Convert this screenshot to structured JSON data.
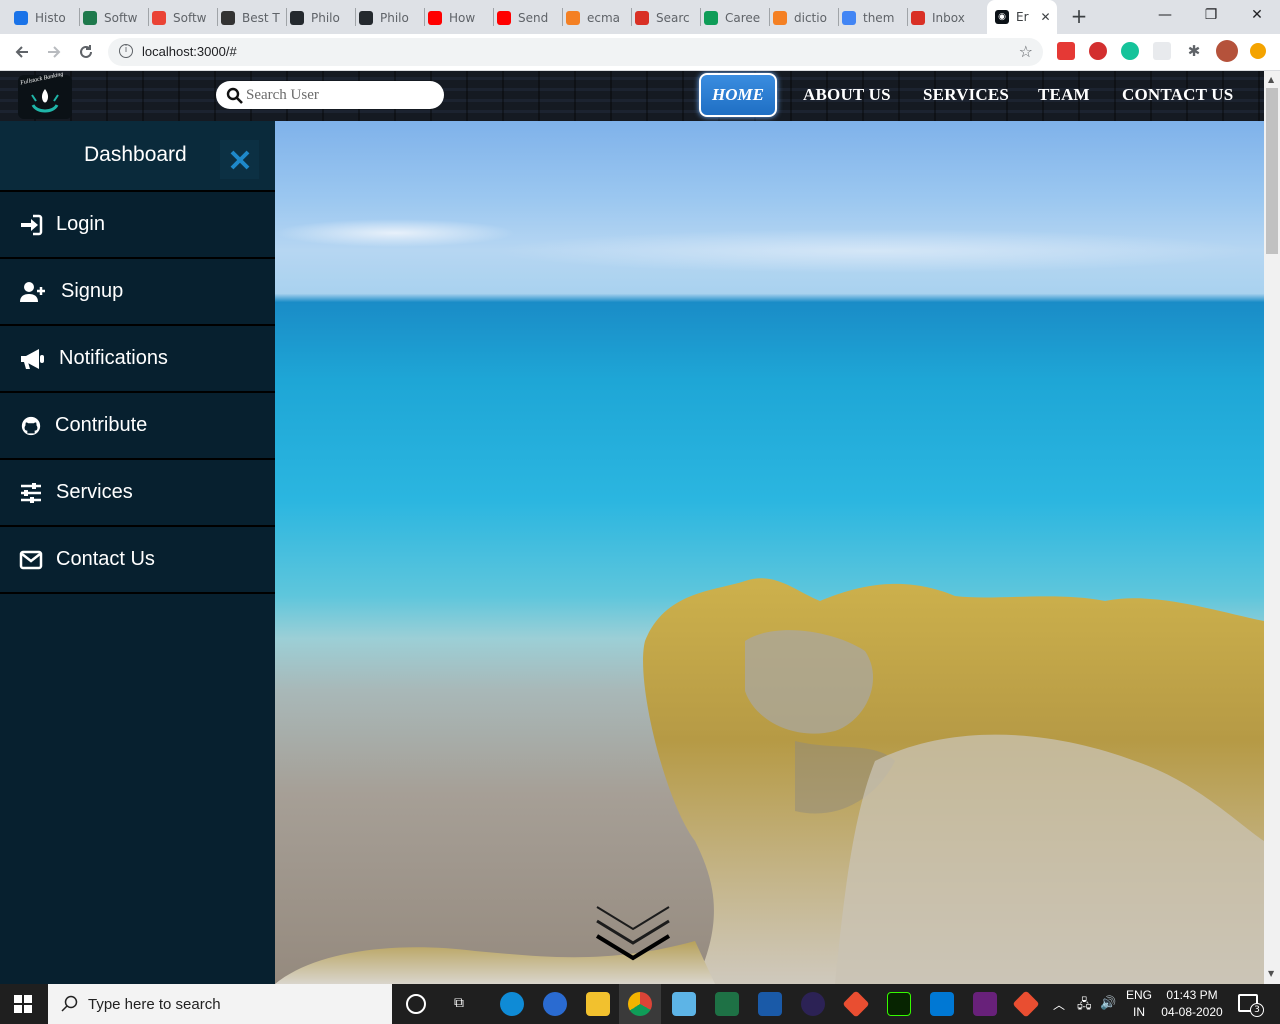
{
  "browser": {
    "tabs": [
      {
        "label": "Histo",
        "color": "#1a73e8"
      },
      {
        "label": "Softw",
        "color": "#1f7a4d"
      },
      {
        "label": "Softw",
        "color": "#ea4335"
      },
      {
        "label": "Best T",
        "color": "#333333"
      },
      {
        "label": "Philo",
        "color": "#24292e"
      },
      {
        "label": "Philo",
        "color": "#24292e"
      },
      {
        "label": "How",
        "color": "#ff0000"
      },
      {
        "label": "Send",
        "color": "#ff0000"
      },
      {
        "label": "ecma",
        "color": "#f48024"
      },
      {
        "label": "Searc",
        "color": "#d93025"
      },
      {
        "label": "Caree",
        "color": "#0f9d58"
      },
      {
        "label": "dictio",
        "color": "#f48024"
      },
      {
        "label": "them",
        "color": "#4285f4"
      },
      {
        "label": "Inbox",
        "color": "#d93025"
      }
    ],
    "active_tab": {
      "label": "Er"
    },
    "new_tab_label": "+",
    "url": "localhost:3000/#",
    "minimize_label": "—",
    "restore_label": "❐",
    "close_label": "✕"
  },
  "navbar": {
    "logo_text": "Fullstack Banking",
    "search_placeholder": "Search User",
    "links": [
      "HOME",
      "ABOUT US",
      "SERVICES",
      "TEAM",
      "CONTACT US"
    ]
  },
  "sidebar": {
    "title": "Dashboard",
    "items": [
      {
        "label": "Login",
        "icon": "login-icon"
      },
      {
        "label": "Signup",
        "icon": "user-plus-icon"
      },
      {
        "label": "Notifications",
        "icon": "megaphone-icon"
      },
      {
        "label": "Contribute",
        "icon": "github-icon"
      },
      {
        "label": "Services",
        "icon": "sliders-icon"
      },
      {
        "label": "Contact Us",
        "icon": "envelope-icon"
      }
    ]
  },
  "taskbar": {
    "search_placeholder": "Type here to search",
    "lang_top": "ENG",
    "lang_bottom": "IN",
    "time": "01:43 PM",
    "date": "04-08-2020",
    "notification_count": "3"
  }
}
